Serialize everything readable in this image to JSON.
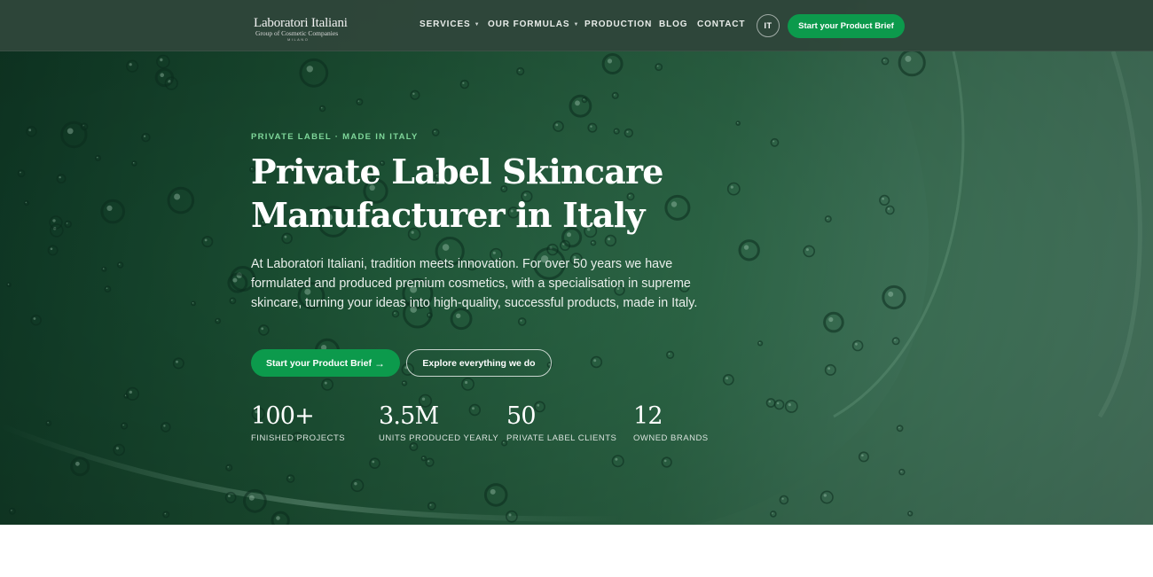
{
  "colors": {
    "accent_green": "#0c9a4c",
    "eyebrow_green": "#7fd79a",
    "hero_dark": "#0f3a26",
    "hero_light": "#5d917a",
    "header_bg": "#2f463a"
  },
  "header": {
    "logo": {
      "name": "Laboratori Italiani",
      "tagline": "Group of Cosmetic Companies",
      "city": "MILANO"
    },
    "nav": [
      {
        "label": "SERVICES",
        "has_dropdown": true
      },
      {
        "label": "OUR FORMULAS",
        "has_dropdown": true
      },
      {
        "label": "PRODUCTION",
        "has_dropdown": false
      },
      {
        "label": "BLOG",
        "has_dropdown": false
      },
      {
        "label": "CONTACT",
        "has_dropdown": false
      }
    ],
    "language": "IT",
    "cta": "Start your Product Brief"
  },
  "hero": {
    "eyebrow": "PRIVATE LABEL · MADE IN ITALY",
    "title_line1": "Private Label Skincare",
    "title_line2": "Manufacturer in Italy",
    "description": "At Laboratori Italiani, tradition meets innovation. For over 50 years we have formulated and produced premium cosmetics, with a specialisation in supreme skincare, turning your ideas into high-quality, successful products, made in Italy.",
    "primary_button": "Start your Product Brief",
    "primary_button_icon": "arrow-right-icon",
    "secondary_button": "Explore everything we do",
    "stats": [
      {
        "value": "100+",
        "label": "FINISHED PROJECTS"
      },
      {
        "value": "3.5M",
        "label": "UNITS PRODUCED YEARLY"
      },
      {
        "value": "50",
        "label": "PRIVATE LABEL CLIENTS"
      },
      {
        "value": "12",
        "label": "OWNED BRANDS"
      }
    ]
  }
}
